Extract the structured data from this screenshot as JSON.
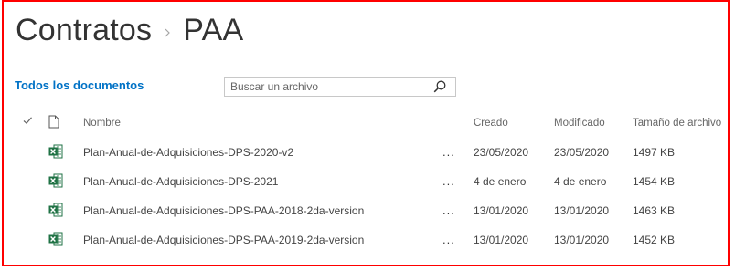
{
  "breadcrumb": {
    "site": "Contratos",
    "library": "PAA"
  },
  "view": {
    "label": "Todos los documentos"
  },
  "search": {
    "placeholder": "Buscar un archivo",
    "value": ""
  },
  "columns": {
    "name": "Nombre",
    "created": "Creado",
    "modified": "Modificado",
    "size": "Tamaño de archivo"
  },
  "files": [
    {
      "name": "Plan-Anual-de-Adquisiciones-DPS-2020-v2",
      "menu": "...",
      "created": "23/05/2020",
      "modified": "23/05/2020",
      "size": "1497 KB",
      "icon": "excel-file-icon"
    },
    {
      "name": "Plan-Anual-de-Adquisiciones-DPS-2021",
      "menu": "...",
      "created": "4 de enero",
      "modified": "4 de enero",
      "size": "1454 KB",
      "icon": "excel-file-icon"
    },
    {
      "name": "Plan-Anual-de-Adquisiciones-DPS-PAA-2018-2da-version",
      "menu": "...",
      "created": "13/01/2020",
      "modified": "13/01/2020",
      "size": "1463 KB",
      "icon": "excel-file-icon"
    },
    {
      "name": "Plan-Anual-de-Adquisiciones-DPS-PAA-2019-2da-version",
      "menu": "...",
      "created": "13/01/2020",
      "modified": "13/01/2020",
      "size": "1452 KB",
      "icon": "excel-file-icon"
    }
  ],
  "colors": {
    "frame": "#ff0000",
    "link": "#0072c6",
    "excel": "#1f7244"
  }
}
